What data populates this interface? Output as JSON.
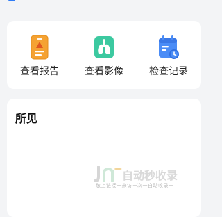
{
  "quick_actions": {
    "items": [
      {
        "label": "查看报告",
        "icon": "report-icon"
      },
      {
        "label": "查看影像",
        "icon": "lung-image-icon"
      },
      {
        "label": "检查记录",
        "icon": "calendar-record-icon"
      }
    ]
  },
  "seen_section": {
    "title": "所见"
  },
  "watermark": {
    "logo_text": "JNE自动秒收录",
    "tagline": "敬上链接一来访一次一自动收录一"
  },
  "colors": {
    "report_icon": "#f5a232",
    "lung_icon": "#3cc9a0",
    "calendar_icon": "#4a8cf6",
    "accent": "#2f7cf6"
  }
}
